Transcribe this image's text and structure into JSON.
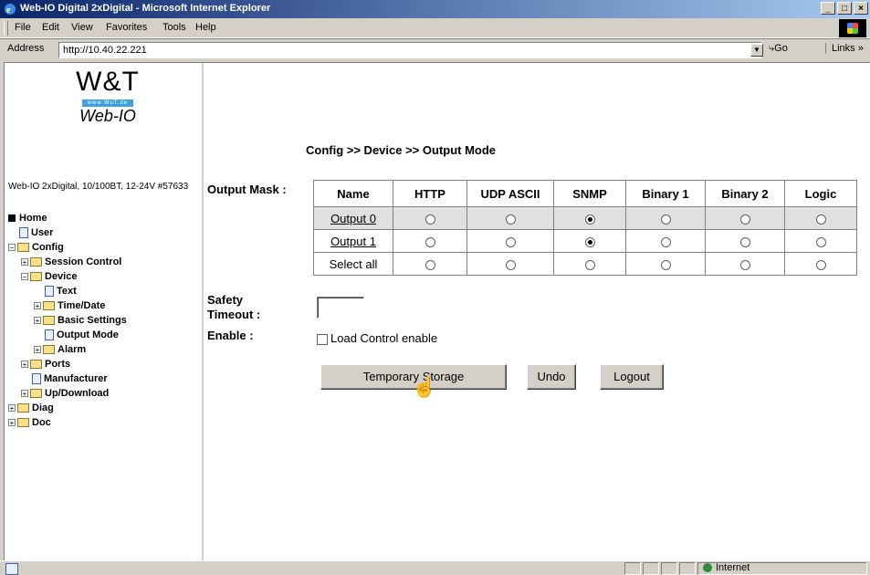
{
  "window": {
    "title": "Web-IO Digital 2xDigital - Microsoft Internet Explorer",
    "buttons": [
      "_",
      "□",
      "×"
    ]
  },
  "menu": [
    "File",
    "Edit",
    "View",
    "Favorites",
    "Tools",
    "Help"
  ],
  "address": {
    "label": "Address",
    "url": "http://10.40.22.221",
    "go": "Go",
    "links": "Links »"
  },
  "logo": {
    "brand": "W&T",
    "site": "www.WuT.de",
    "product": "Web-IO"
  },
  "device_info": "Web-IO 2xDigital, 10/100BT, 12-24V #57633",
  "tree": [
    {
      "label": "Home",
      "icon": "home-icon"
    },
    {
      "label": "User",
      "icon": "page-icon"
    },
    {
      "label": "Config",
      "icon": "folder-icon"
    },
    {
      "label": "Session Control",
      "icon": "folder-icon"
    },
    {
      "label": "Device",
      "icon": "folder-icon"
    },
    {
      "label": "Text",
      "icon": "page-icon"
    },
    {
      "label": "Time/Date",
      "icon": "folder-icon"
    },
    {
      "label": "Basic Settings",
      "icon": "folder-icon"
    },
    {
      "label": "Output Mode",
      "icon": "page-icon"
    },
    {
      "label": "Alarm",
      "icon": "folder-icon"
    },
    {
      "label": "Ports",
      "icon": "folder-icon"
    },
    {
      "label": "Manufacturer",
      "icon": "page-icon"
    },
    {
      "label": "Up/Download",
      "icon": "folder-icon"
    },
    {
      "label": "Diag",
      "icon": "folder-icon"
    },
    {
      "label": "Doc",
      "icon": "folder-icon"
    }
  ],
  "page": {
    "breadcrumb": "Config >> Device >> Output Mode",
    "output_mask_label": "Output Mask :",
    "columns": [
      "Name",
      "HTTP",
      "UDP ASCII",
      "SNMP",
      "Binary 1",
      "Binary 2",
      "Logic"
    ],
    "rows": [
      {
        "name": "Output 0",
        "selected": "SNMP"
      },
      {
        "name": "Output 1",
        "selected": "SNMP"
      },
      {
        "name": "Select all",
        "selected": ""
      }
    ],
    "safety_label_1": "Safety",
    "safety_label_2": "Timeout :",
    "safety_value": "",
    "enable_label": "Enable :",
    "load_control_label": "Load Control enable",
    "buttons": {
      "temp_storage": "Temporary Storage",
      "undo": "Undo",
      "logout": "Logout"
    }
  },
  "status": {
    "zone": "Internet"
  }
}
